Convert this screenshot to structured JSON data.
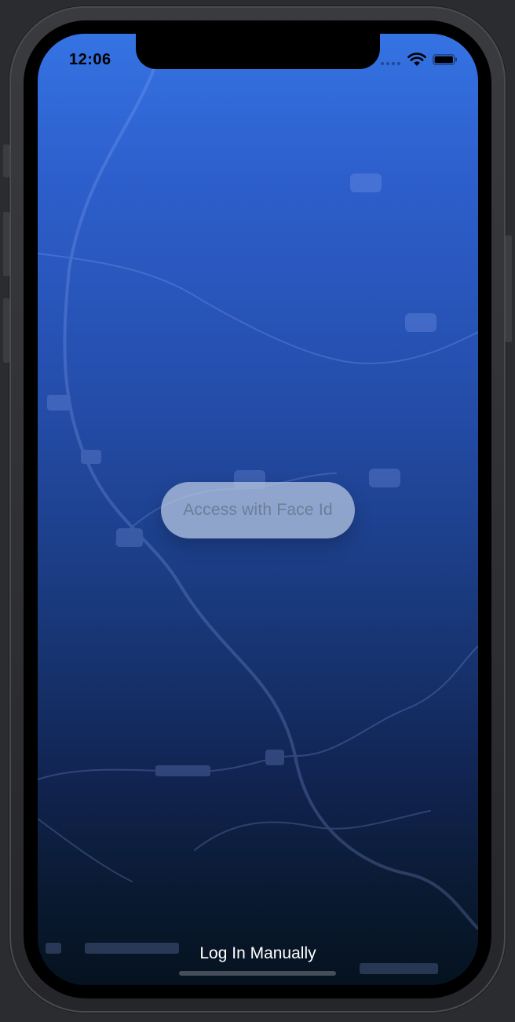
{
  "status_bar": {
    "time": "12:06",
    "icons": [
      "cellular-signal-icon",
      "wifi-icon",
      "battery-icon"
    ]
  },
  "main": {
    "face_id_button_label": "Access with Face Id",
    "login_manually_label": "Log In Manually"
  },
  "colors": {
    "gradient_top": "#3573e3",
    "gradient_bottom": "#05121f",
    "button_fill": "#bbcae2",
    "button_text": "#6b7e99",
    "link_text": "#ffffff"
  }
}
